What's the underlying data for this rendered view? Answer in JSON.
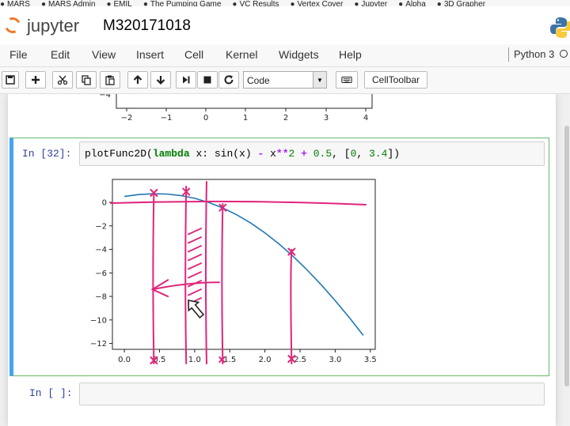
{
  "bookmarks": [
    "MARS",
    "MARS Admin",
    "EMIL",
    "The Pumping Game",
    "VC Results",
    "Vertex Cover",
    "Jupyter",
    "Alpha",
    "3D Grapher"
  ],
  "header": {
    "logo_text": "jupyter",
    "notebook_title": "M320171018"
  },
  "menu": [
    "File",
    "Edit",
    "View",
    "Insert",
    "Cell",
    "Kernel",
    "Widgets",
    "Help"
  ],
  "kernel": {
    "name": "Python 3"
  },
  "toolbar": {
    "cell_type": "Code",
    "celltoolbar_label": "CellToolbar"
  },
  "cells": [
    {
      "prompt": "In [32]:",
      "code": {
        "func": "plotFunc2D",
        "kw": "lambda",
        "var": " x: sin(x) ",
        "op1": "-",
        "mid": " x",
        "op2": "**",
        "n1": "2",
        "rest": " ",
        "op3": "+",
        "n2": " 0.5",
        "tail": ", [",
        "n3": "0",
        "sep": ", ",
        "n4": "3.4",
        "end": "])"
      }
    },
    {
      "prompt": "In [ ]:",
      "code": ""
    }
  ],
  "prev_plot": {
    "xticks": [
      "−2",
      "−1",
      "0",
      "1",
      "2",
      "3",
      "4"
    ],
    "ytick_visible": "−4"
  },
  "chart_data": {
    "type": "line",
    "x": [
      0,
      0.2,
      0.4,
      0.6,
      0.8,
      1.0,
      1.2,
      1.4,
      1.6,
      1.8,
      2.0,
      2.2,
      2.4,
      2.6,
      2.8,
      3.0,
      3.2,
      3.4
    ],
    "series": [
      {
        "values": [
          0.5,
          0.659,
          0.729,
          0.705,
          0.577,
          0.341,
          -0.008,
          -0.475,
          -1.06,
          -1.766,
          -2.591,
          -3.532,
          -4.585,
          -5.745,
          -7.005,
          -8.359,
          -9.798,
          -11.316
        ],
        "color": "#1f77b4"
      }
    ],
    "xticks": [
      "0.0",
      "0.5",
      "1.0",
      "1.5",
      "2.0",
      "2.5",
      "3.0",
      "3.5"
    ],
    "xtick_values": [
      0,
      0.5,
      1.0,
      1.5,
      2.0,
      2.5,
      3.0,
      3.5
    ],
    "yticks": [
      "0",
      "−2",
      "−4",
      "−6",
      "−8",
      "−10",
      "−12"
    ],
    "ytick_values": [
      0,
      -2,
      -4,
      -6,
      -8,
      -10,
      -12
    ],
    "xlim": [
      -0.17,
      3.57
    ],
    "ylim": [
      -12.5,
      1.95
    ],
    "grid": false,
    "title": "",
    "xlabel": "",
    "ylabel": ""
  },
  "annotation_color": "#e0257a"
}
